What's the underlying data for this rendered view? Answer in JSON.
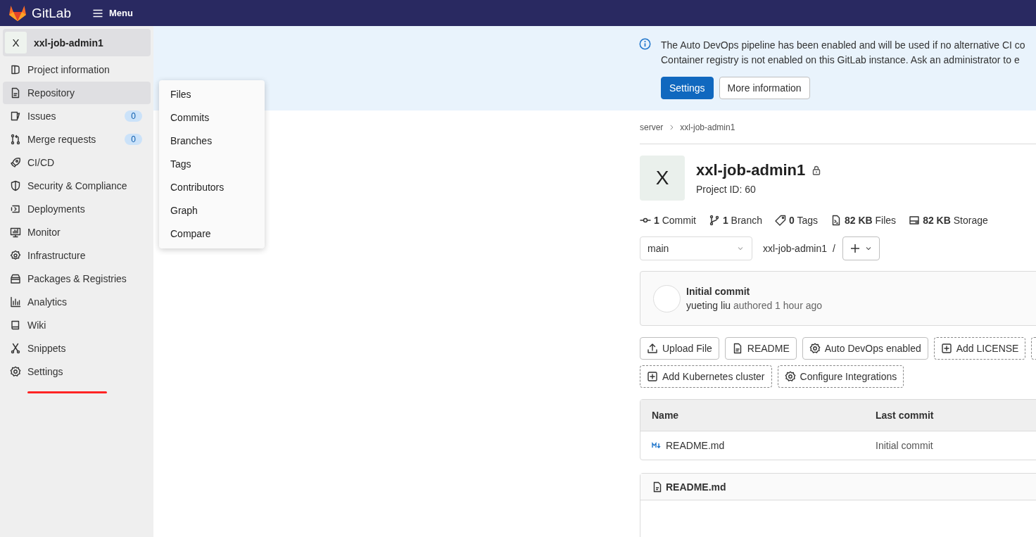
{
  "top_bar": {
    "logo_text": "GitLab",
    "menu_label": "Menu"
  },
  "sidebar": {
    "project": {
      "avatar_letter": "X",
      "name": "xxl-job-admin1"
    },
    "items": [
      {
        "label": "Project information",
        "selected": false
      },
      {
        "label": "Repository",
        "selected": true
      },
      {
        "label": "Issues",
        "selected": false,
        "count": "0"
      },
      {
        "label": "Merge requests",
        "selected": false,
        "count": "0"
      },
      {
        "label": "CI/CD",
        "selected": false
      },
      {
        "label": "Security & Compliance",
        "selected": false
      },
      {
        "label": "Deployments",
        "selected": false
      },
      {
        "label": "Monitor",
        "selected": false
      },
      {
        "label": "Infrastructure",
        "selected": false
      },
      {
        "label": "Packages & Registries",
        "selected": false
      },
      {
        "label": "Analytics",
        "selected": false
      },
      {
        "label": "Wiki",
        "selected": false
      },
      {
        "label": "Snippets",
        "selected": false
      },
      {
        "label": "Settings",
        "selected": false
      }
    ],
    "annotation": {
      "kind": "underline"
    }
  },
  "flyout_menu": {
    "items": [
      "Files",
      "Commits",
      "Branches",
      "Tags",
      "Contributors",
      "Graph",
      "Compare"
    ]
  },
  "banner": {
    "lines": [
      "The Auto DevOps pipeline has been enabled and will be used if no alternative CI co",
      "Container registry is not enabled on this GitLab instance. Ask an administrator to e"
    ],
    "buttons": [
      {
        "label": "Settings",
        "kind": "primary"
      },
      {
        "label": "More information",
        "kind": "default"
      }
    ]
  },
  "breadcrumb": [
    "server",
    "xxl-job-admin1"
  ],
  "project": {
    "avatar_letter": "X",
    "name": "xxl-job-admin1",
    "private": true,
    "id_text": "Project ID: 60"
  },
  "stats": [
    {
      "value": "1",
      "label": "Commit"
    },
    {
      "value": "1",
      "label": "Branch"
    },
    {
      "value": "0",
      "label": "Tags"
    },
    {
      "value": "82 KB",
      "label": "Files"
    },
    {
      "value": "82 KB",
      "label": "Storage"
    }
  ],
  "branch_select": {
    "value": "main"
  },
  "path": {
    "name": "xxl-job-admin1",
    "separator": "/"
  },
  "last_commit": {
    "title": "Initial commit",
    "author": "yueting liu",
    "meta": "authored 1 hour ago"
  },
  "action_buttons": [
    {
      "label": "Upload File",
      "dashed": false
    },
    {
      "label": "README",
      "dashed": false
    },
    {
      "label": "Auto DevOps enabled",
      "dashed": false
    },
    {
      "label": "Add LICENSE",
      "dashed": true
    },
    {
      "dashed": true
    },
    {
      "label": "Add Kubernetes cluster",
      "dashed": true
    },
    {
      "label": "Configure Integrations",
      "dashed": true
    }
  ],
  "file_table": {
    "columns": [
      "Name",
      "Last commit"
    ],
    "rows": [
      {
        "name": "README.md",
        "last_commit": "Initial commit"
      }
    ]
  },
  "readme": {
    "title": "README.md"
  }
}
